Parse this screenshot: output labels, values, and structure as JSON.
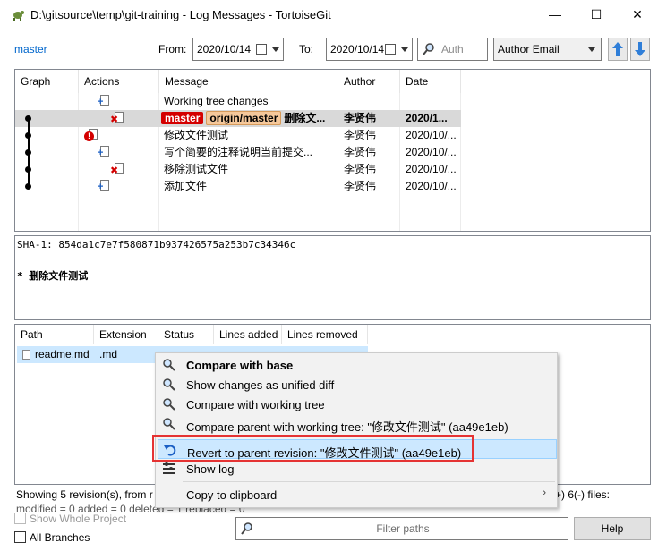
{
  "window": {
    "title": "D:\\gitsource\\temp\\git-training - Log Messages - TortoiseGit",
    "minimize": "—",
    "maximize": "☐",
    "close": "✕"
  },
  "toolbar": {
    "branch": "master",
    "from_label": "From:",
    "from_date": "2020/10/14",
    "to_label": "To:",
    "to_date": "2020/10/14",
    "search_placeholder": "Auth",
    "filter_field": "Author Email"
  },
  "log": {
    "columns": [
      "Graph",
      "Actions",
      "Message",
      "Author",
      "Date"
    ],
    "rows": [
      {
        "message": "Working tree changes",
        "author": "",
        "date": ""
      },
      {
        "refs": [
          "master",
          "origin/master"
        ],
        "message": "删除文...",
        "author": "李贤伟",
        "date": "2020/1..."
      },
      {
        "message": "修改文件测试",
        "author": "李贤伟",
        "date": "2020/10/..."
      },
      {
        "message": "写个简要的注释说明当前提交...",
        "author": "李贤伟",
        "date": "2020/10/..."
      },
      {
        "message": "移除测试文件",
        "author": "李贤伟",
        "date": "2020/10/..."
      },
      {
        "message": "添加文件",
        "author": "李贤伟",
        "date": "2020/10/..."
      }
    ]
  },
  "commit": {
    "sha": "SHA-1: 854da1c7e7f580871b937426575a253b7c34346c",
    "message": "* 删除文件测试"
  },
  "files": {
    "columns": [
      "Path",
      "Extension",
      "Status",
      "Lines added",
      "Lines removed"
    ],
    "rows": [
      {
        "path": "readme.md",
        "extension": ".md",
        "status": "",
        "added": "",
        "removed": ""
      }
    ]
  },
  "status": {
    "line1_left": "Showing 5 revision(s), from r",
    "line1_right": "+) 6(-) files:",
    "line2": "modified = 0 added = 0 deleted = 1 replaced = 0"
  },
  "options": {
    "show_whole_project": "Show Whole Project",
    "all_branches": "All Branches",
    "filter_placeholder": "Filter paths",
    "help": "Help"
  },
  "context_menu": {
    "items": [
      {
        "label": "Compare with base",
        "icon": "magnifier-icon",
        "bold": true
      },
      {
        "label": "Show changes as unified diff",
        "icon": "magnifier-icon"
      },
      {
        "label": "Compare with working tree",
        "icon": "magnifier-icon"
      },
      {
        "label": "Compare parent with working tree: \"修改文件测试\" (aa49e1eb)",
        "icon": "magnifier-icon"
      },
      {
        "label": "Revert to parent revision: \"修改文件测试\" (aa49e1eb)",
        "icon": "undo-icon",
        "highlighted": true
      },
      {
        "label": "Show log",
        "icon": "log-icon"
      },
      {
        "label": "Copy to clipboard",
        "icon": "",
        "submenu": true
      }
    ]
  },
  "colors": {
    "selection": "#cce8ff",
    "highlight_border": "#e53333",
    "tag_master": "#d40000",
    "link": "#0066cc"
  }
}
